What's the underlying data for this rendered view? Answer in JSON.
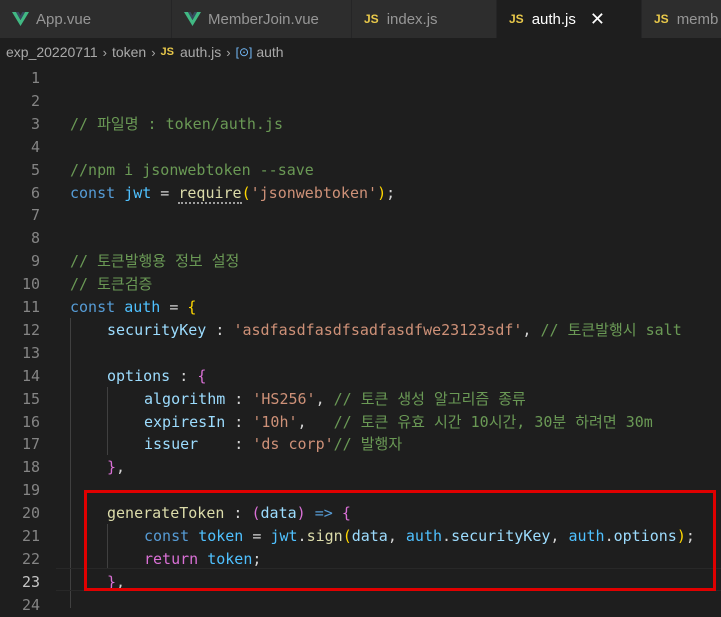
{
  "tabs": [
    {
      "label": "App.vue",
      "icon": "vue-icon"
    },
    {
      "label": "MemberJoin.vue",
      "icon": "vue-icon"
    },
    {
      "label": "index.js",
      "icon": "js-icon"
    },
    {
      "label": "auth.js",
      "icon": "js-icon",
      "active": true,
      "close": "✕"
    },
    {
      "label": "memb",
      "icon": "js-icon"
    }
  ],
  "breadcrumb": {
    "folder": "exp_20220711",
    "subfolder": "token",
    "file": "auth.js",
    "symbol": "auth",
    "js_badge": "JS"
  },
  "editor": {
    "current_line": 23,
    "lines": [
      {
        "n": "1"
      },
      {
        "n": "2"
      },
      {
        "n": "3"
      },
      {
        "n": "4"
      },
      {
        "n": "5"
      },
      {
        "n": "6"
      },
      {
        "n": "7"
      },
      {
        "n": "8"
      },
      {
        "n": "9"
      },
      {
        "n": "10"
      },
      {
        "n": "11"
      },
      {
        "n": "12"
      },
      {
        "n": "13"
      },
      {
        "n": "14"
      },
      {
        "n": "15"
      },
      {
        "n": "16"
      },
      {
        "n": "17"
      },
      {
        "n": "18"
      },
      {
        "n": "19"
      },
      {
        "n": "20"
      },
      {
        "n": "21"
      },
      {
        "n": "22"
      },
      {
        "n": "23"
      },
      {
        "n": "24"
      }
    ],
    "code": {
      "l3": "// 파일명 : token/auth.js",
      "l5": "//npm i jsonwebtoken --save",
      "l6_const": "const",
      "l6_jwt": "jwt",
      "l6_eq": " = ",
      "l6_require": "require",
      "l6_open": "(",
      "l6_str": "'jsonwebtoken'",
      "l6_close": ")",
      "l6_semi": ";",
      "l9": "// 토큰발행용 정보 설정",
      "l10": "// 토큰검증",
      "l11_const": "const",
      "l11_auth": "auth",
      "l11_eq": " = ",
      "l11_brace": "{",
      "l12_key": "securityKey",
      "l12_colon": " : ",
      "l12_str": "'asdfasdfasdfsadfasdfwe23123sdf'",
      "l12_comma": ", ",
      "l12_comment": "// 토큰발행시 salt",
      "l14_key": "options",
      "l14_colon": " : ",
      "l14_brace": "{",
      "l15_key": "algorithm",
      "l15_colon": " : ",
      "l15_str": "'HS256'",
      "l15_comma": ", ",
      "l15_comment": "// 토큰 생성 알고리즘 종류",
      "l16_key": "expiresIn",
      "l16_colon": " : ",
      "l16_str": "'10h'",
      "l16_comma": ",   ",
      "l16_comment": "// 토큰 유효 시간 10시간, 30분 하려면 30m",
      "l17_key": "issuer",
      "l17_colon": "    : ",
      "l17_str": "'ds corp'",
      "l17_comment": "// 발행자",
      "l18_brace": "}",
      "l18_comma": ",",
      "l20_key": "generateToken",
      "l20_colon": " : ",
      "l20_open": "(",
      "l20_param": "data",
      "l20_close": ")",
      "l20_arrow": " => ",
      "l20_brace": "{",
      "l21_const": "const",
      "l21_token": "token",
      "l21_eq": " = ",
      "l21_jwt": "jwt",
      "l21_dot": ".",
      "l21_sign": "sign",
      "l21_open": "(",
      "l21_data": "data",
      "l21_c1": ", ",
      "l21_auth1": "auth",
      "l21_dot2": ".",
      "l21_sk": "securityKey",
      "l21_c2": ", ",
      "l21_auth2": "auth",
      "l21_dot3": ".",
      "l21_opt": "options",
      "l21_close": ")",
      "l21_semi": ";",
      "l22_return": "return",
      "l22_token": "token",
      "l22_semi": ";",
      "l23_brace": "}",
      "l23_comma": ","
    }
  },
  "colors": {
    "highlight_box": "#e00000",
    "background": "#1e1e1e"
  }
}
